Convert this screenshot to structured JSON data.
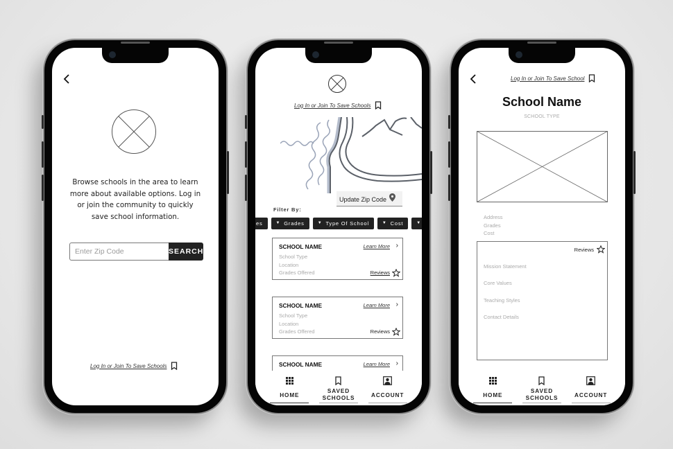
{
  "common": {
    "back_icon": "chevron-left-icon",
    "bookmark_icon": "bookmark-icon",
    "tabs": [
      {
        "label": "HOME",
        "icon": "grid-icon"
      },
      {
        "label": "SAVED\nSCHOOLS",
        "label_line1": "SAVED",
        "label_line2": "SCHOOLS",
        "icon": "bookmark-icon"
      },
      {
        "label": "ACCOUNT",
        "icon": "account-icon"
      }
    ],
    "active_tab": "HOME"
  },
  "screen1": {
    "intro_text": "Browse schools in the area to learn more about available options. Log in or join the community to quickly save school information.",
    "zip_placeholder": "Enter Zip Code",
    "zip_value": "",
    "search_label": "SEARCH",
    "login_link": "Log In or Join To Save Schools"
  },
  "screen2": {
    "login_link": "Log In or Join To Save Schools",
    "update_zip_label": "Update Zip Code",
    "filter_label": "Filter By:",
    "filters": [
      "es",
      "Grades",
      "Type Of School",
      "Cost",
      ""
    ],
    "cards": [
      {
        "name": "SCHOOL NAME",
        "learn_more": "Learn More",
        "type": "School Type",
        "location": "Location",
        "grades": "Grades Offered",
        "reviews": "Reviews"
      },
      {
        "name": "SCHOOL NAME",
        "learn_more": "Learn More",
        "type": "School Type",
        "location": "Location",
        "grades": "Grades Offered",
        "reviews": "Reviews"
      },
      {
        "name": "SCHOOL NAME",
        "learn_more": "Learn More"
      }
    ]
  },
  "screen3": {
    "login_link": "Log In or Join To Save School",
    "school_name": "School Name",
    "school_type": "SCHOOL TYPE",
    "meta": [
      "Address",
      "Grades",
      "Cost"
    ],
    "reviews_label": "Reviews",
    "info_items": [
      "Mission Statement",
      "Core Values",
      "Teaching Styles",
      "Contact Details"
    ]
  },
  "colors": {
    "background": "#e6e6e6",
    "phone_frame": "#050505",
    "dark_button": "#222222",
    "muted_text": "#aaaaaa",
    "map_line": "#5b6068",
    "map_water": "#b4bccb"
  }
}
